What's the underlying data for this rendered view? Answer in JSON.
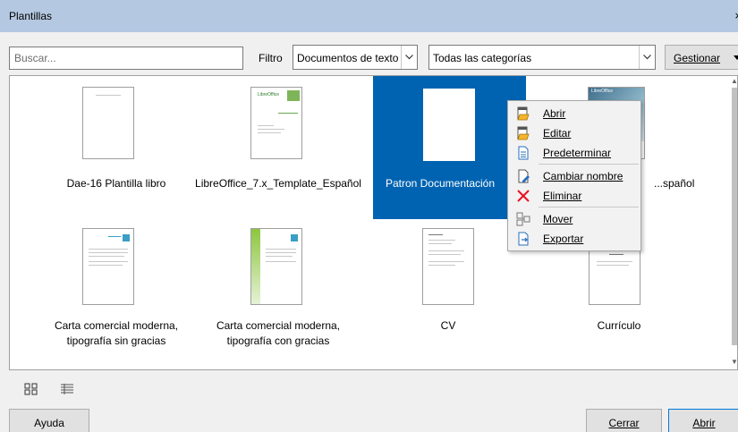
{
  "window": {
    "title": "Plantillas",
    "close_glyph": "×"
  },
  "toolbar": {
    "search_placeholder": "Buscar...",
    "filter_label": "Filtro",
    "filter_value": "Documentos de texto",
    "category_value": "Todas las categorías",
    "manage_label": "Gestionar"
  },
  "templates": [
    {
      "label": "Dae-16 Plantilla libro",
      "selected": false
    },
    {
      "label": "LibreOffice_7.x_Template_Español",
      "selected": false
    },
    {
      "label": "Patron Documentación",
      "selected": true
    },
    {
      "label": "...spañol",
      "selected": false
    },
    {
      "label": "Carta comercial moderna, tipografía sin gracias",
      "selected": false
    },
    {
      "label": "Carta comercial moderna, tipografía con gracias",
      "selected": false
    },
    {
      "label": "CV",
      "selected": false
    },
    {
      "label": "Currículo",
      "selected": false
    }
  ],
  "thumb_text": {
    "lo_logo": "LibreOffice"
  },
  "context_menu": {
    "items": [
      {
        "label": "Abrir",
        "icon": "open-icon"
      },
      {
        "label": "Editar",
        "icon": "edit-icon"
      },
      {
        "label": "Predeterminar",
        "icon": "default-icon"
      },
      {
        "label": "Cambiar nombre",
        "icon": "rename-icon"
      },
      {
        "label": "Eliminar",
        "icon": "delete-icon"
      },
      {
        "label": "Mover",
        "icon": "move-icon"
      },
      {
        "label": "Exportar",
        "icon": "export-icon"
      }
    ]
  },
  "footer": {
    "help_label": "Ayuda",
    "close_label": "Cerrar",
    "open_label": "Abrir"
  },
  "colors": {
    "selection": "#0063b1",
    "titlebar": "#b4c8e1",
    "delete": "#e81123"
  }
}
